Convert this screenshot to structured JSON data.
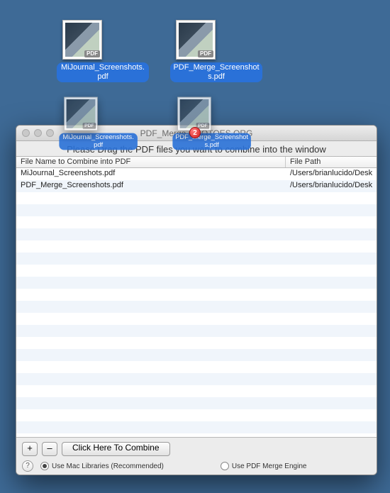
{
  "desktop": {
    "icons": [
      {
        "label": "MiJournal_Screenshots.pdf",
        "badge": "PDF"
      },
      {
        "label": "PDF_Merge_Screenshots.pdf",
        "badge": "PDF"
      }
    ],
    "drag_copies": [
      {
        "label": "MiJournal_Screenshots.pdf",
        "badge": "PDF"
      },
      {
        "label": "PDF_Merge_Screenshots.pdf",
        "badge": "PDF"
      }
    ]
  },
  "window": {
    "title": "PDF_Merge ©GOTOES.ORG",
    "badge_count": "2",
    "instruction": "Please Drag the PDF files you want to combine into the window",
    "columns": {
      "name": "File Name to Combine into PDF",
      "path": "File Path"
    },
    "rows": [
      {
        "name": "MiJournal_Screenshots.pdf",
        "path": "/Users/brianlucido/Desk"
      },
      {
        "name": "PDF_Merge_Screenshots.pdf",
        "path": "/Users/brianlucido/Desk"
      }
    ],
    "buttons": {
      "add": "+",
      "remove": "–",
      "combine": "Click Here To Combine"
    },
    "options": {
      "help": "?",
      "mac_lib": "Use Mac Libraries (Recommended)",
      "engine": "Use PDF Merge Engine"
    }
  }
}
